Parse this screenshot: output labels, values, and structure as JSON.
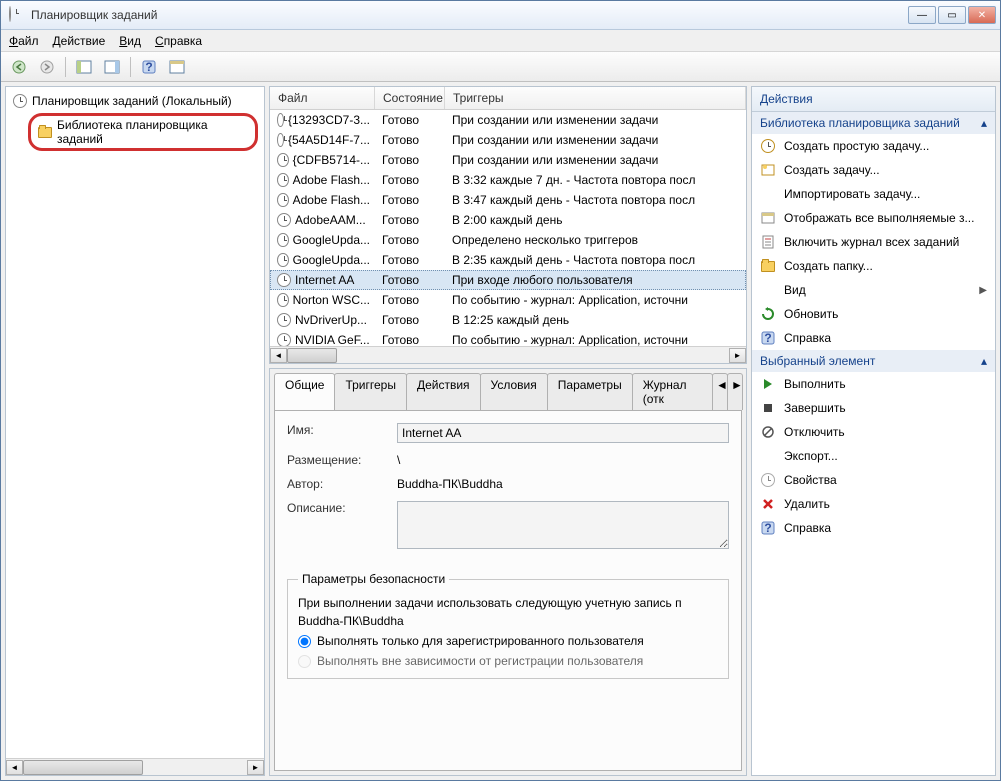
{
  "window": {
    "title": "Планировщик заданий"
  },
  "menubar": {
    "file": "Файл",
    "action": "Действие",
    "view": "Вид",
    "help": "Справка"
  },
  "tree": {
    "root": "Планировщик заданий (Локальный)",
    "library": "Библиотека планировщика заданий"
  },
  "task_list": {
    "columns": {
      "file": "Файл",
      "state": "Состояние",
      "trigger": "Триггеры"
    },
    "rows": [
      {
        "name": "{13293CD7-3...",
        "state": "Готово",
        "trigger": "При создании или изменении задачи"
      },
      {
        "name": "{54A5D14F-7...",
        "state": "Готово",
        "trigger": "При создании или изменении задачи"
      },
      {
        "name": "{CDFB5714-...",
        "state": "Готово",
        "trigger": "При создании или изменении задачи"
      },
      {
        "name": "Adobe Flash...",
        "state": "Готово",
        "trigger": "В 3:32 каждые 7 дн. - Частота повтора посл"
      },
      {
        "name": "Adobe Flash...",
        "state": "Готово",
        "trigger": "В 3:47 каждый день - Частота повтора посл"
      },
      {
        "name": "AdobeAAM...",
        "state": "Готово",
        "trigger": "В 2:00 каждый день"
      },
      {
        "name": "GoogleUpda...",
        "state": "Готово",
        "trigger": "Определено несколько триггеров"
      },
      {
        "name": "GoogleUpda...",
        "state": "Готово",
        "trigger": "В 2:35 каждый день - Частота повтора посл"
      },
      {
        "name": "Internet AA",
        "state": "Готово",
        "trigger": "При входе любого пользователя",
        "selected": true
      },
      {
        "name": "Norton WSC...",
        "state": "Готово",
        "trigger": "По событию - журнал: Application, источни"
      },
      {
        "name": "NvDriverUp...",
        "state": "Готово",
        "trigger": "В 12:25 каждый день"
      },
      {
        "name": "NVIDIA GeF...",
        "state": "Готово",
        "trigger": "По событию - журнал: Application, источни"
      }
    ]
  },
  "tabs": {
    "general": "Общие",
    "triggers": "Триггеры",
    "actions": "Действия",
    "conditions": "Условия",
    "settings": "Параметры",
    "log": "Журнал (отк"
  },
  "detail": {
    "name_label": "Имя:",
    "name_value": "Internet AA",
    "location_label": "Размещение:",
    "location_value": "\\",
    "author_label": "Автор:",
    "author_value": "Buddha-ПК\\Buddha",
    "description_label": "Описание:",
    "security_legend": "Параметры безопасности",
    "security_text": "При выполнении задачи использовать следующую учетную запись п",
    "security_account": "Buddha-ПК\\Buddha",
    "radio1": "Выполнять только для зарегистрированного пользователя",
    "radio2": "Выполнять вне зависимости от регистрации пользователя"
  },
  "actions_panel": {
    "header": "Действия",
    "section1": "Библиотека планировщика заданий",
    "items1": [
      {
        "icon": "task-simple",
        "label": "Создать простую задачу..."
      },
      {
        "icon": "task",
        "label": "Создать задачу..."
      },
      {
        "icon": "import",
        "label": "Импортировать задачу..."
      },
      {
        "icon": "show-running",
        "label": "Отображать все выполняемые з..."
      },
      {
        "icon": "enable-log",
        "label": "Включить журнал всех заданий"
      },
      {
        "icon": "folder",
        "label": "Создать папку..."
      },
      {
        "icon": "view",
        "label": "Вид",
        "submenu": true
      },
      {
        "icon": "refresh",
        "label": "Обновить"
      },
      {
        "icon": "help",
        "label": "Справка"
      }
    ],
    "section2": "Выбранный элемент",
    "items2": [
      {
        "icon": "run",
        "label": "Выполнить"
      },
      {
        "icon": "end",
        "label": "Завершить"
      },
      {
        "icon": "disable",
        "label": "Отключить"
      },
      {
        "icon": "export",
        "label": "Экспорт..."
      },
      {
        "icon": "properties",
        "label": "Свойства"
      },
      {
        "icon": "delete",
        "label": "Удалить"
      },
      {
        "icon": "help",
        "label": "Справка"
      }
    ]
  }
}
